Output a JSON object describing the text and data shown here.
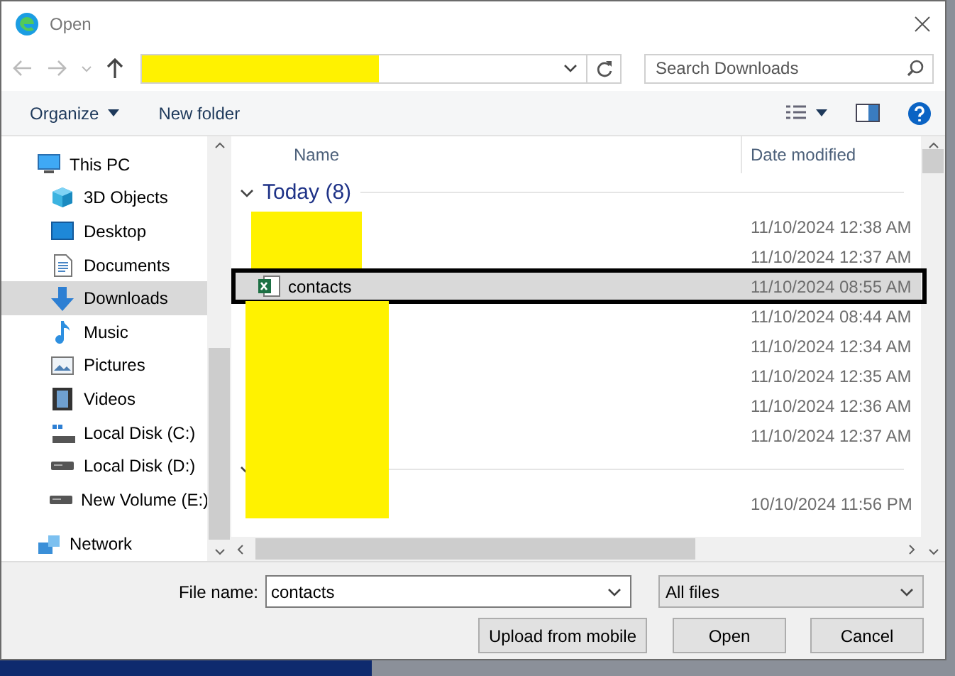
{
  "window": {
    "title": "Open"
  },
  "address_bar": {
    "redacted": true
  },
  "search": {
    "placeholder": "Search Downloads"
  },
  "toolbar": {
    "organize": "Organize",
    "new_folder": "New folder"
  },
  "sidebar": {
    "items": [
      {
        "label": "This PC",
        "kind": "pc",
        "selected": false,
        "children": [
          {
            "label": "3D Objects",
            "kind": "cube",
            "selected": false
          },
          {
            "label": "Desktop",
            "kind": "desktop",
            "selected": false
          },
          {
            "label": "Documents",
            "kind": "document",
            "selected": false
          },
          {
            "label": "Downloads",
            "kind": "download",
            "selected": true
          },
          {
            "label": "Music",
            "kind": "music",
            "selected": false
          },
          {
            "label": "Pictures",
            "kind": "pictures",
            "selected": false
          },
          {
            "label": "Videos",
            "kind": "videos",
            "selected": false
          },
          {
            "label": "Local Disk (C:)",
            "kind": "system-drive",
            "selected": false
          },
          {
            "label": "Local Disk (D:)",
            "kind": "drive",
            "selected": false
          },
          {
            "label": "New Volume (E:)",
            "kind": "drive",
            "selected": false
          }
        ]
      },
      {
        "label": "Network",
        "kind": "network",
        "selected": false
      }
    ]
  },
  "file_list": {
    "columns": [
      "Name",
      "Date modified"
    ],
    "groups": [
      {
        "label": "Today (8)",
        "kind": "labeled",
        "rows": [
          {
            "kind": "redacted-narrow",
            "date": "11/10/2024 12:38 AM",
            "selected": false,
            "outlined": false
          },
          {
            "kind": "redacted-narrow",
            "date": "11/10/2024 12:37 AM",
            "selected": false,
            "outlined": false
          },
          {
            "kind": "excel",
            "name": "contacts",
            "date": "11/10/2024 08:55 AM",
            "selected": true,
            "outlined": true
          },
          {
            "kind": "redacted-wide",
            "date": "11/10/2024 08:44 AM",
            "selected": false,
            "outlined": false
          },
          {
            "kind": "redacted-wide",
            "date": "11/10/2024 12:34 AM",
            "selected": false,
            "outlined": false
          },
          {
            "kind": "redacted-wide",
            "date": "11/10/2024 12:35 AM",
            "selected": false,
            "outlined": false
          },
          {
            "kind": "redacted-wide",
            "date": "11/10/2024 12:36 AM",
            "selected": false,
            "outlined": false
          },
          {
            "kind": "redacted-wide",
            "date": "11/10/2024 12:37 AM",
            "selected": false,
            "outlined": false
          }
        ]
      },
      {
        "kind": "redacted-wide",
        "rows": [
          {
            "kind": "redacted-wide",
            "date": "10/10/2024 11:56 PM",
            "selected": false,
            "outlined": false
          }
        ]
      }
    ]
  },
  "file_name": {
    "label": "File name:",
    "value": "contacts"
  },
  "file_type": {
    "value": "All files"
  },
  "buttons": [
    "Upload from mobile",
    "Open",
    "Cancel"
  ]
}
